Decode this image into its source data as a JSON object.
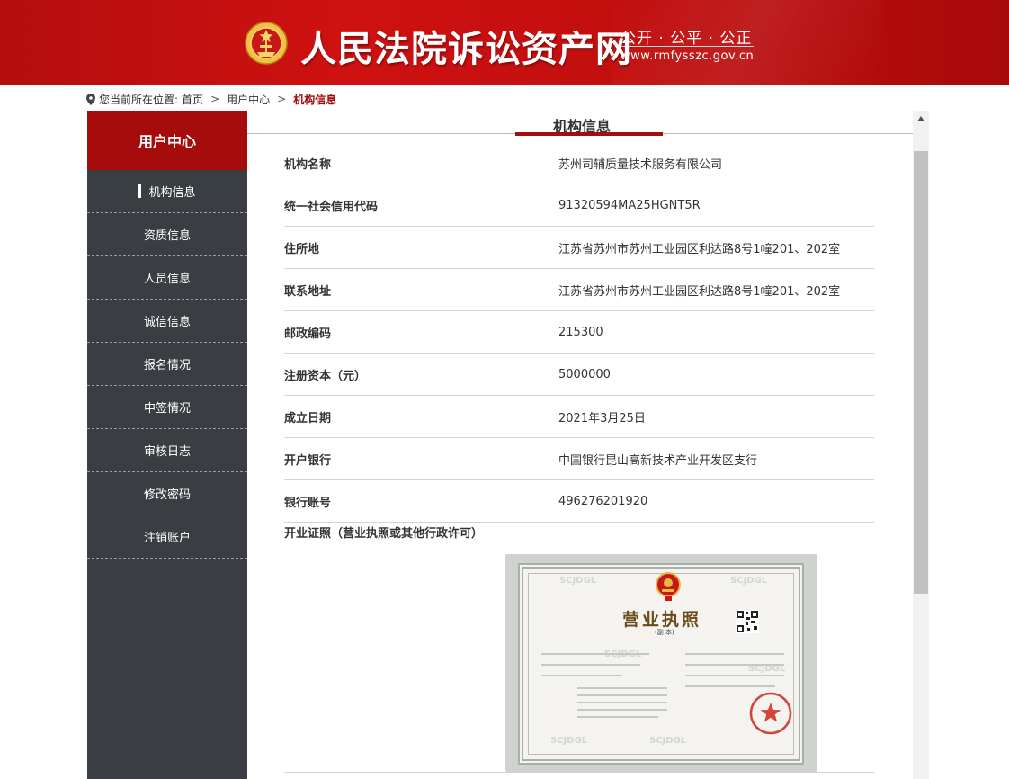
{
  "header": {
    "title": "人民法院诉讼资产网",
    "slogan": "公开 · 公平 · 公正",
    "domain": "www.rmfysszc.gov.cn",
    "colors": {
      "primary": "#c10e0e",
      "accent": "#a60c0c"
    }
  },
  "breadcrumb": {
    "prefix": "您当前所在位置:",
    "items": [
      "首页",
      "用户中心",
      "机构信息"
    ],
    "separator": ">"
  },
  "sidebar": {
    "title": "用户中心",
    "items": [
      {
        "label": "机构信息",
        "active": true
      },
      {
        "label": "资质信息"
      },
      {
        "label": "人员信息"
      },
      {
        "label": "诚信信息"
      },
      {
        "label": "报名情况"
      },
      {
        "label": "中签情况"
      },
      {
        "label": "审核日志"
      },
      {
        "label": "修改密码"
      },
      {
        "label": "注销账户"
      }
    ]
  },
  "content": {
    "title": "机构信息",
    "rows": [
      {
        "label": "机构名称",
        "value": "苏州司辅质量技术服务有限公司"
      },
      {
        "label": "统一社会信用代码",
        "value": "91320594MA25HGNT5R"
      },
      {
        "label": "住所地",
        "value": "江苏省苏州市苏州工业园区利达路8号1幢201、202室"
      },
      {
        "label": "联系地址",
        "value": "江苏省苏州市苏州工业园区利达路8号1幢201、202室"
      },
      {
        "label": "邮政编码",
        "value": "215300"
      },
      {
        "label": "注册资本（元）",
        "value": "5000000"
      },
      {
        "label": "成立日期",
        "value": "2021年3月25日"
      },
      {
        "label": "开户银行",
        "value": "中国银行昆山高新技术产业开发区支行"
      },
      {
        "label": "银行账号",
        "value": "496276201920"
      }
    ],
    "license_label": "开业证照（营业执照或其他行政许可）",
    "license": {
      "title": "营业执照",
      "copy_mark": "(副 本)",
      "watermark": "SCJDGL"
    }
  },
  "icons": {
    "location": "location-pin-icon",
    "emblem": "court-emblem-icon",
    "scroll_up": "triangle-up-icon"
  }
}
